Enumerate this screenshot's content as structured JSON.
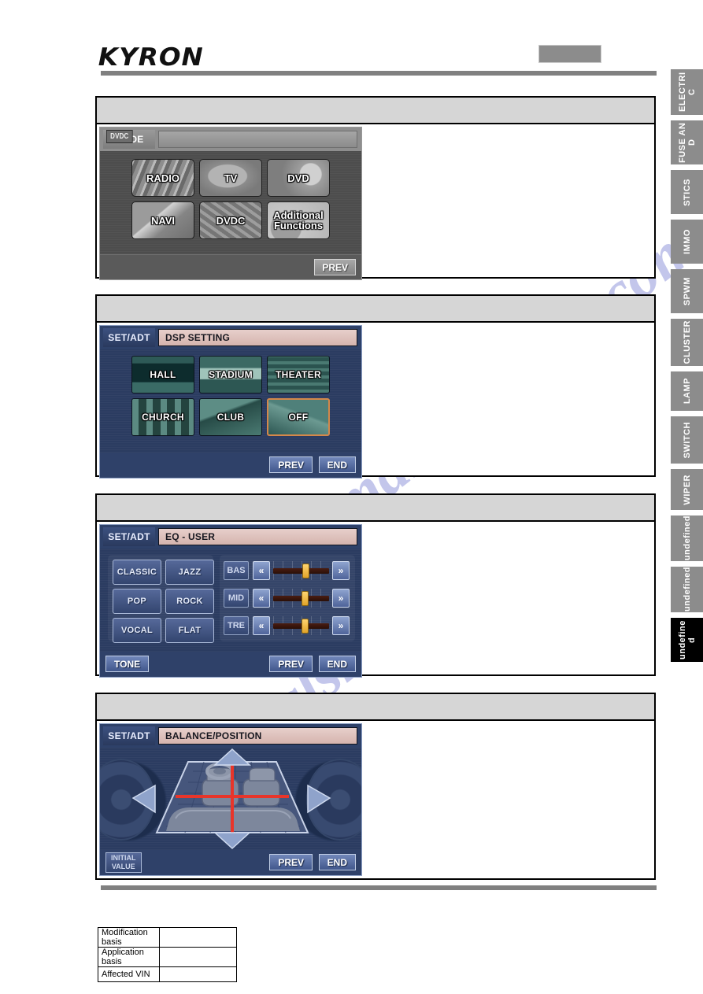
{
  "document": {
    "logo": "KYRON",
    "watermark": "manualshive.com"
  },
  "sidebar": {
    "tabs": [
      {
        "label": "ELECTRIC",
        "active": false
      },
      {
        "label": "FUSE AND",
        "active": false
      },
      {
        "label": "STICS",
        "active": false
      },
      {
        "label": "IMMO",
        "active": false
      },
      {
        "label": "SPWM",
        "active": false
      },
      {
        "label": "CLUSTER",
        "active": false
      },
      {
        "label": "LAMP",
        "active": false
      },
      {
        "label": "SWITCH",
        "active": false
      },
      {
        "label": "WIPER",
        "active": false
      },
      {
        "label": "undefined",
        "active": false
      },
      {
        "label": "undefined",
        "active": false
      },
      {
        "label": "undefined",
        "active": true
      }
    ]
  },
  "sections": [
    {
      "id": "mode",
      "screen": {
        "tag": "MODE",
        "title": "",
        "badge": "DVDC",
        "buttons": [
          "RADIO",
          "TV",
          "DVD",
          "NAVI",
          "DVDC",
          "Additional Functions"
        ],
        "footer": [
          "PREV"
        ]
      }
    },
    {
      "id": "dsp",
      "screen": {
        "tag": "SET/ADT",
        "title": "DSP SETTING",
        "buttons": [
          "HALL",
          "STADIUM",
          "THEATER",
          "CHURCH",
          "CLUB",
          "OFF"
        ],
        "selected": "OFF",
        "footer": [
          "PREV",
          "END"
        ]
      }
    },
    {
      "id": "eq",
      "screen": {
        "tag": "SET/ADT",
        "title": "EQ - USER",
        "presets": [
          "CLASSIC",
          "JAZZ",
          "POP",
          "ROCK",
          "VOCAL",
          "FLAT"
        ],
        "sliders": [
          {
            "label": "BAS",
            "left": "«",
            "right": "»",
            "position": 52
          },
          {
            "label": "MID",
            "left": "«",
            "right": "»",
            "position": 50
          },
          {
            "label": "TRE",
            "left": "«",
            "right": "»",
            "position": 50
          }
        ],
        "tone_label": "TONE",
        "footer": [
          "PREV",
          "END"
        ]
      }
    },
    {
      "id": "balance",
      "screen": {
        "tag": "SET/ADT",
        "title": "BALANCE/POSITION",
        "initial_value_line1": "INITIAL",
        "initial_value_line2": "VALUE",
        "footer": [
          "PREV",
          "END"
        ]
      }
    }
  ],
  "meta_table": {
    "rows": [
      {
        "key": "Modification basis",
        "value": ""
      },
      {
        "key": "Application basis",
        "value": ""
      },
      {
        "key": "Affected VIN",
        "value": ""
      }
    ]
  },
  "colors": {
    "rule": "#808080",
    "section_head": "#d6d6d6",
    "tab": "#8c8c8c",
    "tab_active": "#000000",
    "hu_blue": "#2b3c61",
    "hu_grey": "#4d4d4d",
    "title_pink": "#e0c2bc",
    "select_orange": "#d4884a",
    "cross_red": "#e8352a",
    "watermark": "#b9bde8"
  }
}
